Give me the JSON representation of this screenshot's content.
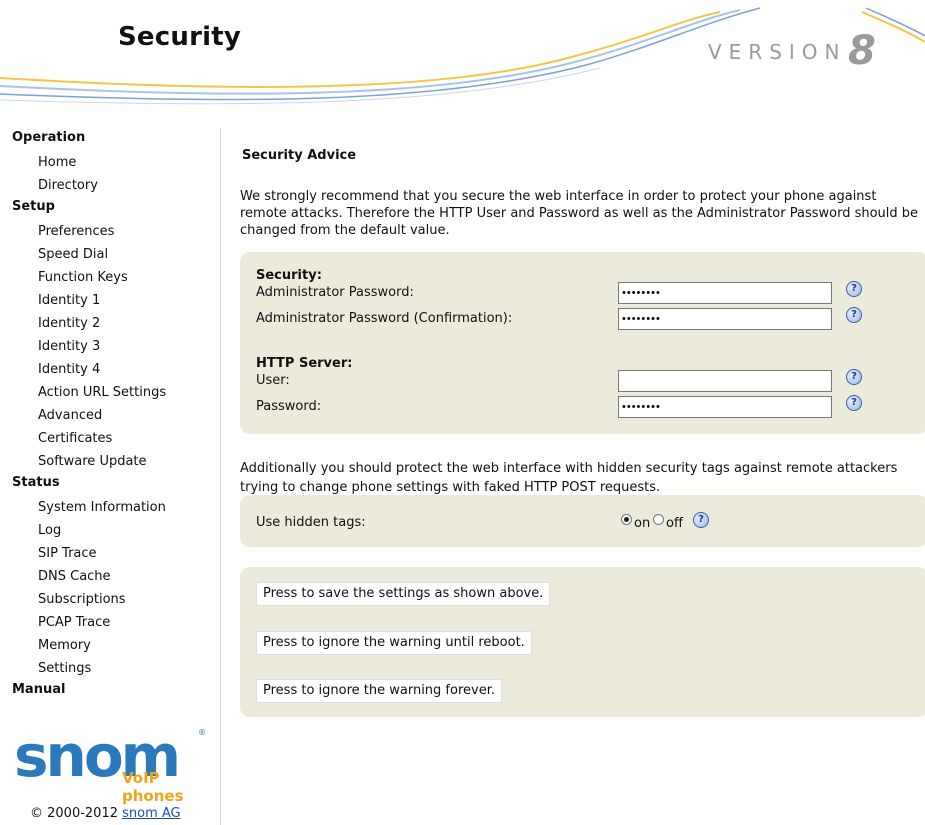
{
  "header": {
    "title": "Security",
    "version_label": "VERSION",
    "version_number": "8"
  },
  "sidebar": {
    "sections": [
      {
        "label": "Operation",
        "items": [
          "Home",
          "Directory"
        ]
      },
      {
        "label": "Setup",
        "items": [
          "Preferences",
          "Speed Dial",
          "Function Keys",
          "Identity 1",
          "Identity 2",
          "Identity 3",
          "Identity 4",
          "Action URL Settings",
          "Advanced",
          "Certificates",
          "Software Update"
        ]
      },
      {
        "label": "Status",
        "items": [
          "System Information",
          "Log",
          "SIP Trace",
          "DNS Cache",
          "Subscriptions",
          "PCAP Trace",
          "Memory",
          "Settings"
        ]
      },
      {
        "label": "Manual",
        "items": []
      }
    ],
    "logo": {
      "word": "snom",
      "sub": "VoIP phones",
      "reg": "®"
    },
    "copyright": {
      "text": "© 2000-2012 ",
      "link": "snom AG"
    }
  },
  "main": {
    "advice_title": "Security Advice",
    "advice_text": "We strongly recommend that you secure the web interface in order to protect your phone against remote attacks. Therefore the HTTP User and Password as well as the Administrator Password should be changed from the default value.",
    "security": {
      "title": "Security:",
      "admin_password_label": "Administrator Password:",
      "admin_password_value": "••••••••",
      "admin_confirm_label": "Administrator Password (Confirmation):",
      "admin_confirm_value": "••••••••"
    },
    "http": {
      "title": "HTTP Server:",
      "user_label": "User:",
      "user_value": "",
      "password_label": "Password:",
      "password_value": "••••••••"
    },
    "help_glyph": "?",
    "additional_text": "Additionally you should protect the web interface with hidden security tags against remote attackers trying to change phone settings with faked HTTP POST requests.",
    "hidden_tags": {
      "label": "Use hidden tags:",
      "on_label": "on",
      "off_label": "off",
      "selected": "on"
    },
    "buttons": {
      "save": "Press to save the settings as shown above.",
      "ignore_reboot": "Press to ignore the warning until reboot.",
      "ignore_forever": "Press to ignore the warning forever."
    }
  },
  "colors": {
    "panel_bg": "#eceadb",
    "logo_blue": "#2a79bc",
    "logo_orange": "#f0a419",
    "link": "#1a4fb0"
  }
}
